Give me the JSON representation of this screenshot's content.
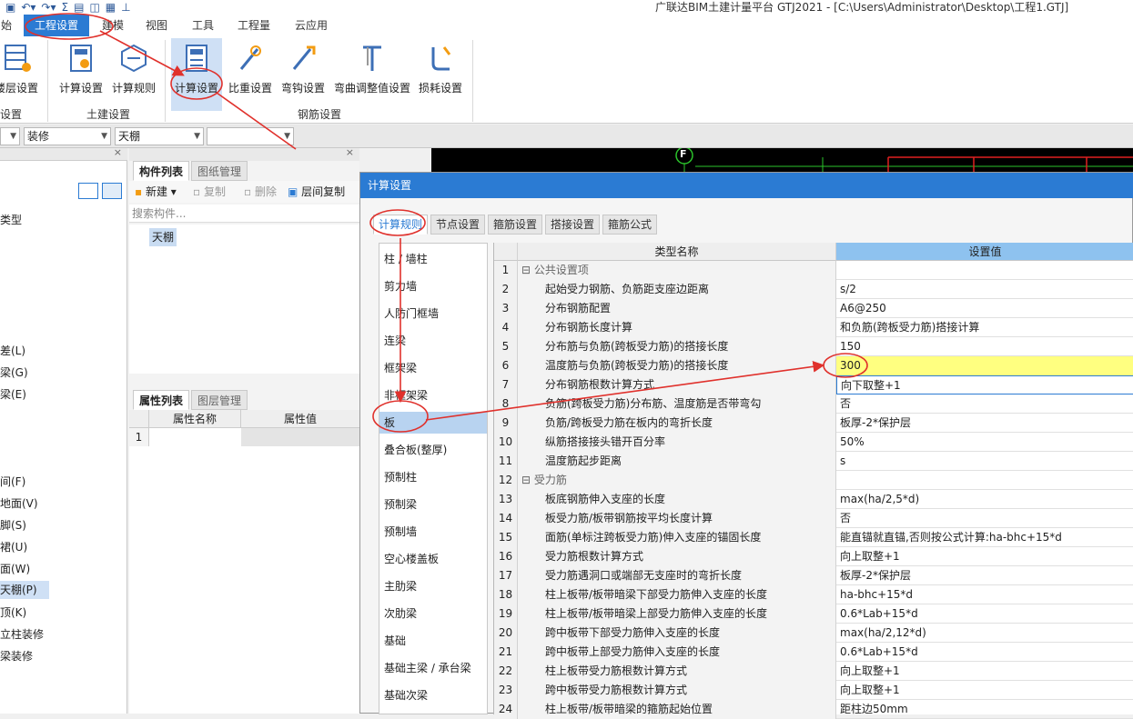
{
  "window": {
    "title": "广联达BIM土建计量平台 GTJ2021 - [C:\\Users\\Administrator\\Desktop\\工程1.GTJ]",
    "qat_icons": [
      "save-icon",
      "undo-icon",
      "redo-icon",
      "sum-icon",
      "report-icon",
      "view-icon",
      "grid-icon",
      "more-icon"
    ]
  },
  "menu": {
    "items": [
      "始",
      "工程设置",
      "建模",
      "视图",
      "工具",
      "工程量",
      "云应用"
    ],
    "active": "工程设置"
  },
  "ribbon": {
    "buttons": [
      "楼层设置",
      "计算设置",
      "计算规则",
      "计算设置",
      "比重设置",
      "弯钩设置",
      "弯曲调整值设置",
      "损耗设置"
    ],
    "groups": [
      "设置",
      "土建设置",
      "钢筋设置"
    ]
  },
  "toolbar": {
    "combos": [
      "",
      "装修",
      "天棚",
      ""
    ]
  },
  "left_panel": {
    "items": [
      "类型",
      "差(L)",
      "梁(G)",
      "梁(E)",
      "间(F)",
      "地面(V)",
      "脚(S)",
      "裙(U)",
      "面(W)",
      "天棚(P)",
      "顶(K)",
      "立柱装修",
      "梁装修"
    ],
    "selected": "天棚(P)"
  },
  "component_panel": {
    "tabs": [
      "构件列表",
      "图纸管理"
    ],
    "actions": [
      "新建",
      "复制",
      "删除",
      "层间复制"
    ],
    "search_placeholder": "搜索构件...",
    "items": [
      "天棚"
    ],
    "prop_tabs": [
      "属性列表",
      "图层管理"
    ],
    "prop_headers": [
      "属性名称",
      "属性值"
    ],
    "prop_rows": [
      "1"
    ]
  },
  "canvas": {
    "axis_label": "F"
  },
  "dialog": {
    "title": "计算设置",
    "tabs": [
      "计算规则",
      "节点设置",
      "箍筋设置",
      "搭接设置",
      "箍筋公式"
    ],
    "categories": [
      "柱 / 墙柱",
      "剪力墙",
      "人防门框墙",
      "连梁",
      "框架梁",
      "非框架梁",
      "板",
      "叠合板(整厚)",
      "预制柱",
      "预制梁",
      "预制墙",
      "空心楼盖板",
      "主肋梁",
      "次肋梁",
      "基础",
      "基础主梁 / 承台梁",
      "基础次梁"
    ],
    "selected_category": "板",
    "grid_headers": [
      "类型名称",
      "设置值"
    ],
    "rows": [
      {
        "n": "1",
        "name": "公共设置项",
        "value": "",
        "group": true
      },
      {
        "n": "2",
        "name": "起始受力钢筋、负筋距支座边距离",
        "value": "s/2"
      },
      {
        "n": "3",
        "name": "分布钢筋配置",
        "value": "A6@250"
      },
      {
        "n": "4",
        "name": "分布钢筋长度计算",
        "value": "和负筋(跨板受力筋)搭接计算"
      },
      {
        "n": "5",
        "name": "分布筋与负筋(跨板受力筋)的搭接长度",
        "value": "150"
      },
      {
        "n": "6",
        "name": "温度筋与负筋(跨板受力筋)的搭接长度",
        "value": "300",
        "highlight": true
      },
      {
        "n": "7",
        "name": "分布钢筋根数计算方式",
        "value": "向下取整+1",
        "current": true
      },
      {
        "n": "8",
        "name": "负筋(跨板受力筋)分布筋、温度筋是否带弯勾",
        "value": "否"
      },
      {
        "n": "9",
        "name": "负筋/跨板受力筋在板内的弯折长度",
        "value": "板厚-2*保护层"
      },
      {
        "n": "10",
        "name": "纵筋搭接接头错开百分率",
        "value": "50%"
      },
      {
        "n": "11",
        "name": "温度筋起步距离",
        "value": "s"
      },
      {
        "n": "12",
        "name": "受力筋",
        "value": "",
        "group": true
      },
      {
        "n": "13",
        "name": "板底钢筋伸入支座的长度",
        "value": "max(ha/2,5*d)"
      },
      {
        "n": "14",
        "name": "板受力筋/板带钢筋按平均长度计算",
        "value": "否"
      },
      {
        "n": "15",
        "name": "面筋(单标注跨板受力筋)伸入支座的锚固长度",
        "value": "能直锚就直锚,否则按公式计算:ha-bhc+15*d"
      },
      {
        "n": "16",
        "name": "受力筋根数计算方式",
        "value": "向上取整+1"
      },
      {
        "n": "17",
        "name": "受力筋遇洞口或端部无支座时的弯折长度",
        "value": "板厚-2*保护层"
      },
      {
        "n": "18",
        "name": "柱上板带/板带暗梁下部受力筋伸入支座的长度",
        "value": "ha-bhc+15*d"
      },
      {
        "n": "19",
        "name": "柱上板带/板带暗梁上部受力筋伸入支座的长度",
        "value": "0.6*Lab+15*d"
      },
      {
        "n": "20",
        "name": "跨中板带下部受力筋伸入支座的长度",
        "value": "max(ha/2,12*d)"
      },
      {
        "n": "21",
        "name": "跨中板带上部受力筋伸入支座的长度",
        "value": "0.6*Lab+15*d"
      },
      {
        "n": "22",
        "name": "柱上板带受力筋根数计算方式",
        "value": "向上取整+1"
      },
      {
        "n": "23",
        "name": "跨中板带受力筋根数计算方式",
        "value": "向上取整+1"
      },
      {
        "n": "24",
        "name": "柱上板带/板带暗梁的箍筋起始位置",
        "value": "距柱边50mm"
      }
    ]
  },
  "colors": {
    "accent": "#2b7bd3",
    "highlight": "#ffff80",
    "annotation": "#e0312c"
  }
}
